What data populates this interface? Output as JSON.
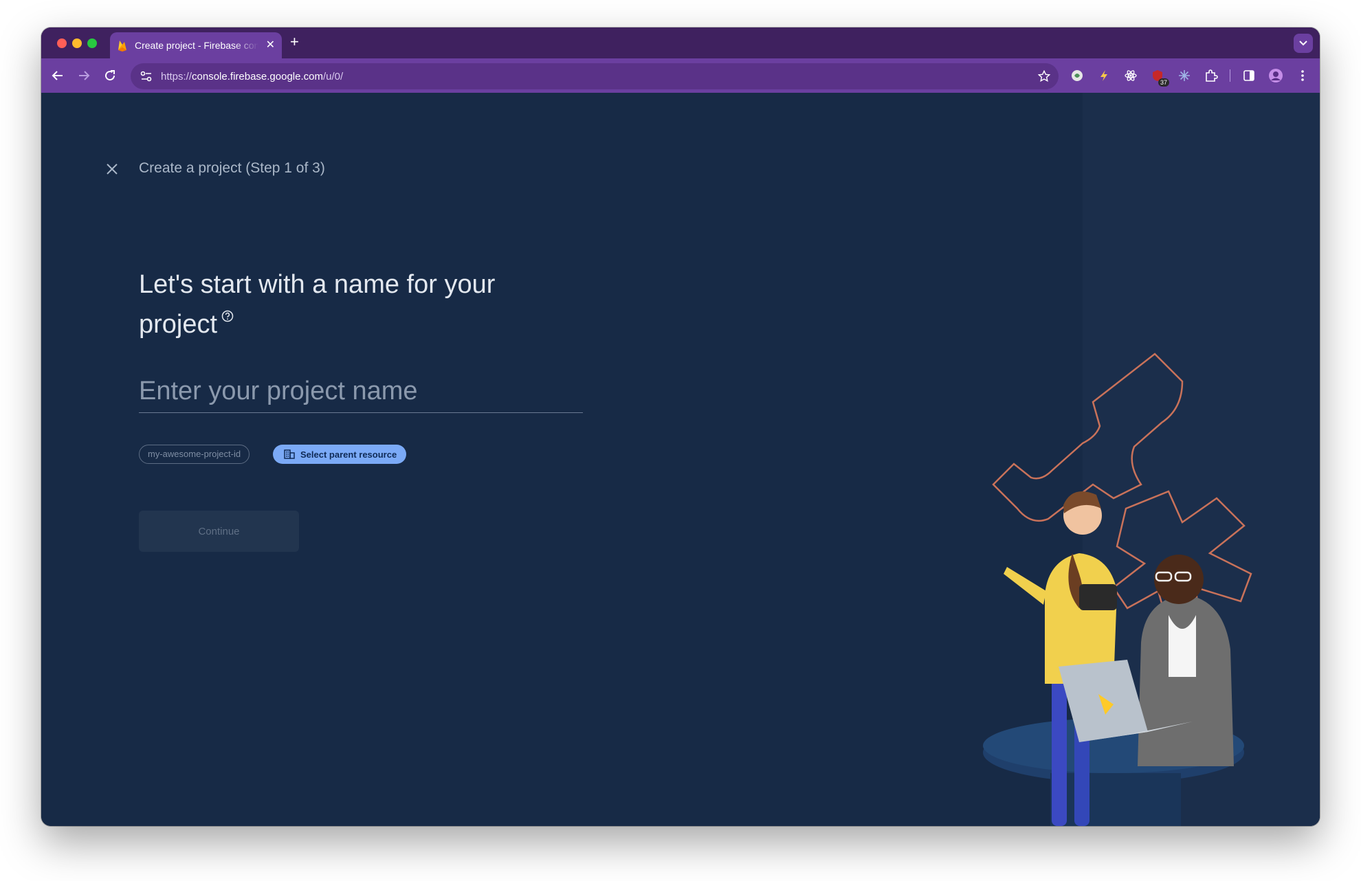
{
  "browser": {
    "tab_title": "Create project - Firebase console",
    "tab_close": "✕",
    "new_tab": "+",
    "url": {
      "scheme": "https://",
      "host": "console.firebase.google.com",
      "path": "/u/0/"
    },
    "extension_badge": "37"
  },
  "page": {
    "step_title": "Create a project (Step 1 of 3)",
    "headline": "Let's start with a name for your project",
    "name_input": {
      "value": "",
      "placeholder": "Enter your project name"
    },
    "project_id_chip": "my-awesome-project-id",
    "parent_resource_chip": "Select parent resource",
    "continue_label": "Continue"
  },
  "colors": {
    "background": "#172a46",
    "browser_frame": "#6b3fa0",
    "accent_chip": "#7baaf7"
  }
}
